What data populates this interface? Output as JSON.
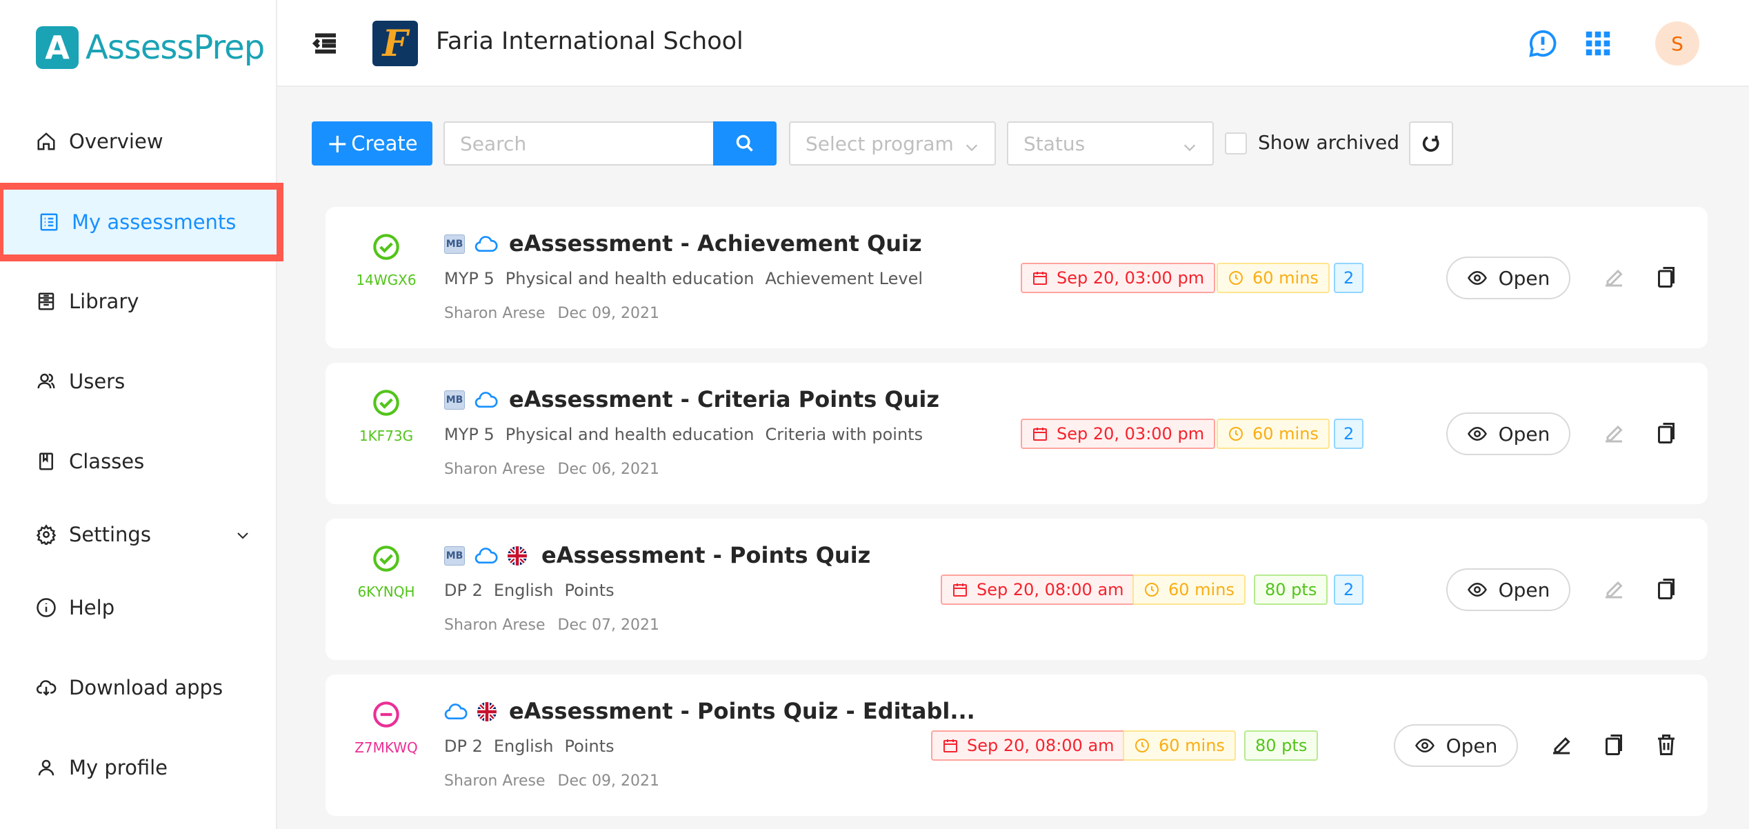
{
  "app": {
    "logo_letter": "A",
    "logo_name": "AssessPrep"
  },
  "header": {
    "school_logo_letter": "F",
    "school_name": "Faria International School",
    "avatar_initial": "S"
  },
  "sidebar": {
    "items": [
      {
        "label": "Overview",
        "icon": "home-icon"
      },
      {
        "label": "My assessments",
        "icon": "list-icon",
        "active": true
      },
      {
        "label": "Library",
        "icon": "library-icon"
      },
      {
        "label": "Users",
        "icon": "users-icon"
      },
      {
        "label": "Classes",
        "icon": "book-icon"
      },
      {
        "label": "Settings",
        "icon": "gear-icon"
      },
      {
        "label": "Help",
        "icon": "info-icon"
      },
      {
        "label": "Download apps",
        "icon": "cloud-download-icon"
      },
      {
        "label": "My profile",
        "icon": "user-icon"
      }
    ]
  },
  "toolbar": {
    "create_label": "Create",
    "search_placeholder": "Search",
    "program_placeholder": "Select program",
    "status_placeholder": "Status",
    "show_archived_label": "Show archived"
  },
  "colors": {
    "primary": "#1890ff",
    "brand": "#1aa3b5",
    "highlight": "#ff5a4e",
    "published": "#52c41a",
    "draft": "#eb2f96"
  },
  "assessments": [
    {
      "code": "14WGX6",
      "status": "published",
      "title": "eAssessment - Achievement Quiz",
      "grade": "MYP 5",
      "subject": "Physical and health education",
      "grading": "Achievement Level",
      "author": "Sharon Arese",
      "created": "Dec 09, 2021",
      "date": "Sep 20, 03:00 pm",
      "duration": "60 mins",
      "points": "",
      "count": "2",
      "mb_badge": "MB",
      "has_flag": false,
      "open_label": "Open"
    },
    {
      "code": "1KF73G",
      "status": "published",
      "title": "eAssessment - Criteria Points Quiz",
      "grade": "MYP 5",
      "subject": "Physical and health education",
      "grading": "Criteria with points",
      "author": "Sharon Arese",
      "created": "Dec 06, 2021",
      "date": "Sep 20, 03:00 pm",
      "duration": "60 mins",
      "points": "",
      "count": "2",
      "mb_badge": "MB",
      "has_flag": false,
      "open_label": "Open"
    },
    {
      "code": "6KYNQH",
      "status": "published",
      "title": "eAssessment - Points Quiz",
      "grade": "DP 2",
      "subject": "English",
      "grading": "Points",
      "author": "Sharon Arese",
      "created": "Dec 07, 2021",
      "date": "Sep 20, 08:00 am",
      "duration": "60 mins",
      "points": "80 pts",
      "count": "2",
      "mb_badge": "MB",
      "has_flag": true,
      "open_label": "Open"
    },
    {
      "code": "Z7MKWQ",
      "status": "draft",
      "title": "eAssessment - Points Quiz - Editabl...",
      "grade": "DP 2",
      "subject": "English",
      "grading": "Points",
      "author": "Sharon Arese",
      "created": "Dec 09, 2021",
      "date": "Sep 20, 08:00 am",
      "duration": "60 mins",
      "points": "80 pts",
      "count": "",
      "mb_badge": "",
      "has_flag": true,
      "open_label": "Open"
    }
  ]
}
